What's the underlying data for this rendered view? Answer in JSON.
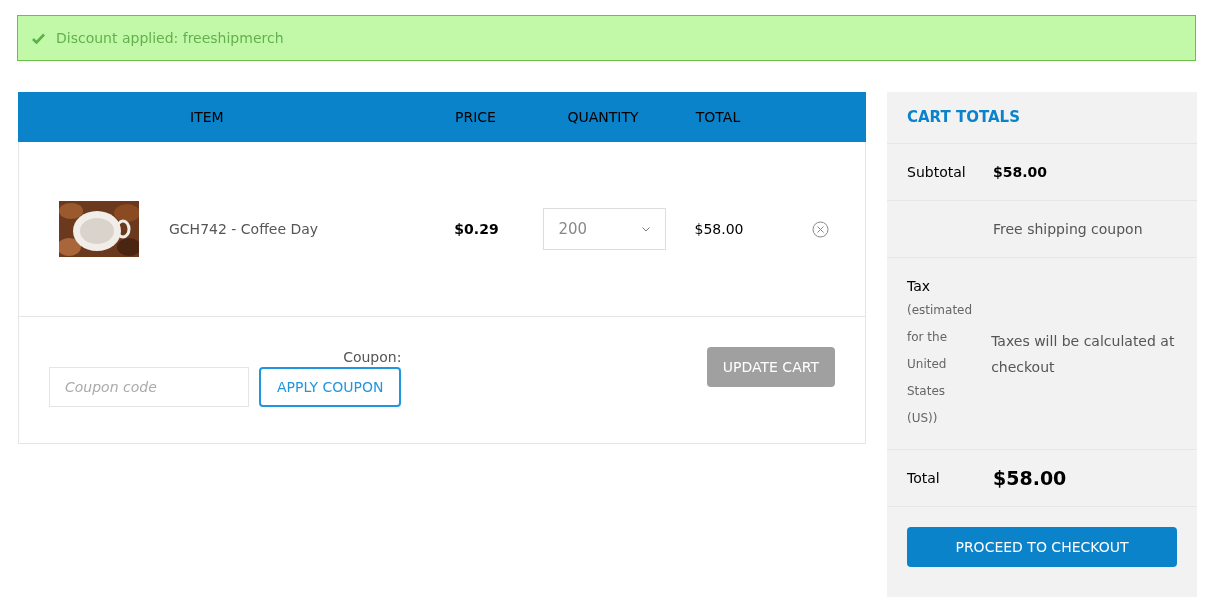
{
  "notice": {
    "text": "Discount applied: freeshipmerch"
  },
  "cart": {
    "columns": [
      "ITEM",
      "PRICE",
      "QUANTITY",
      "TOTAL"
    ],
    "rows": [
      {
        "name": "GCH742 - Coffee Day",
        "price": "$0.29",
        "quantity": "200",
        "total": "$58.00"
      }
    ],
    "coupon_label": "Coupon:",
    "coupon_placeholder": "Coupon code",
    "apply_button": "APPLY COUPON",
    "update_button": "UPDATE CART"
  },
  "totals": {
    "title": "CART TOTALS",
    "subtotal_label": "Subtotal",
    "subtotal": "$58.00",
    "shipping": "Free shipping coupon",
    "tax_label": "Tax",
    "tax_note": "(estimated for the United States (US))",
    "tax_value": "Taxes will be calculated at checkout",
    "total_label": "Total",
    "total": "$58.00",
    "checkout_button": "PROCEED TO CHECKOUT"
  }
}
